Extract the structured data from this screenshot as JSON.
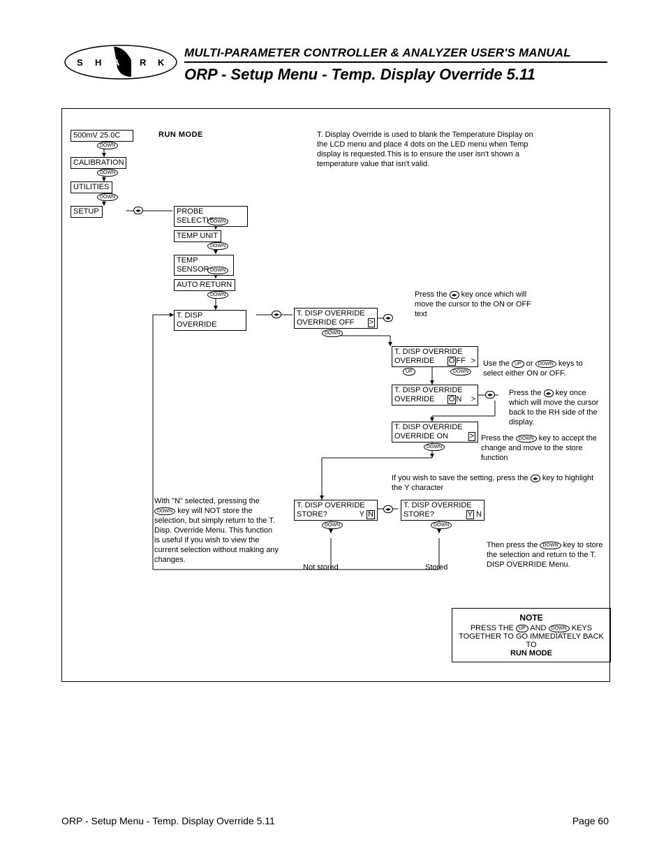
{
  "header": {
    "super": "MULTI-PARAMETER CONTROLLER & ANALYZER USER'S MANUAL",
    "title": "ORP - Setup Menu - Temp. Display Override 5.11"
  },
  "logo": {
    "letters": [
      "S",
      "H",
      "A",
      "R",
      "K"
    ]
  },
  "labels": {
    "run_mode": "RUN MODE"
  },
  "menu": {
    "top1": "500mV  25.0C",
    "top2": "CALIBRATION",
    "top3": "UTILITIES",
    "top4": "SETUP",
    "sub1": "PROBE SELECTION",
    "sub2": "TEMP UNIT",
    "sub3": "TEMP SENSOR",
    "sub4": "AUTO RETURN",
    "sub5": "T. DISP OVERRIDE"
  },
  "screens": {
    "s1_l1": "T. DISP OVERRIDE",
    "s1_l2a": "OVERRIDE  OFF",
    "s2_l2a": "OVERRIDE",
    "s2_off": "O",
    "s2_off_rest": "FF",
    "s3_on": "O",
    "s3_on_rest": "N",
    "s4_l2a": "OVERRIDE     ON",
    "store_l1": "T. DISP OVERRIDE",
    "store_l2": "STORE?",
    "y": "Y",
    "n": "N",
    "gt": ">",
    "not_stored": "Not stored",
    "stored": "Stored"
  },
  "desc": {
    "main": "T. Display Override is used to blank the Temperature Display on the LCD menu and place 4 dots on the LED menu when Temp display is requested.This is to ensure the user isn't shown a temperature value that isn't valid.",
    "d1a": "Press the",
    "d1b": "key once which will move the cursor to the ON or OFF text",
    "d2a": "Use the",
    "d2b": "or",
    "d2c": "keys to select either ON or OFF.",
    "d3a": "Press the",
    "d3b": "key once which will move the cursor back to the RH side of the display.",
    "d4a": "Press the",
    "d4b": "key to accept the change and move to the store function",
    "d5a": "If you wish to save the setting, press the",
    "d5b": "key to highlight the Y character",
    "d6a": "With \"N\" selected, pressing the",
    "d6b": "key will NOT store the selection, but simply return to the T. Disp. Override Menu. This function is useful if you wish to view the current selection without making any changes.",
    "d7a": "Then press the",
    "d7b": "key to store the selection and return to the T. DISP OVERRIDE Menu."
  },
  "keys": {
    "down": "DOWN",
    "up": "UP",
    "lr": "◂▸"
  },
  "note": {
    "title": "NOTE",
    "l1a": "PRESS THE",
    "l1b": "AND",
    "l1c": "KEYS",
    "l2": "TOGETHER TO GO IMMEDIATELY BACK TO",
    "l3": "RUN MODE"
  },
  "footer": {
    "left": "ORP - Setup Menu - Temp. Display Override 5.11",
    "right": "Page 60"
  }
}
